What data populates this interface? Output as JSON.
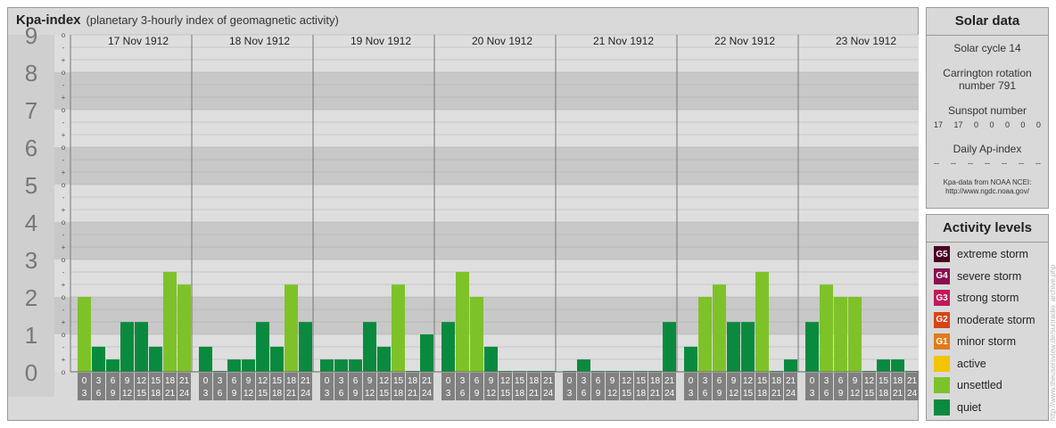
{
  "title": "Kpa-index",
  "subtitle": "(planetary 3-hourly index of geomagnetic activity)",
  "colors": {
    "quiet": "#0a8a3e",
    "unsettled": "#7ec229",
    "active": "#f5c400",
    "minor": "#e07b1a",
    "moderate": "#d84315",
    "strong": "#c2185b",
    "severe": "#880e4f",
    "extreme": "#4a0025"
  },
  "chart_data": {
    "type": "bar",
    "ylim": [
      0,
      9
    ],
    "y_ticks": [
      "0",
      "1",
      "2",
      "3",
      "4",
      "5",
      "6",
      "7",
      "8",
      "9"
    ],
    "sub_ticks": [
      "o",
      "+",
      "-"
    ],
    "days": [
      "17 Nov 1912",
      "18 Nov 1912",
      "19 Nov 1912",
      "20 Nov 1912",
      "21 Nov 1912",
      "22 Nov 1912",
      "23 Nov 1912"
    ],
    "intervals": [
      [
        "0",
        "3"
      ],
      [
        "3",
        "6"
      ],
      [
        "6",
        "9"
      ],
      [
        "9",
        "12"
      ],
      [
        "12",
        "15"
      ],
      [
        "15",
        "18"
      ],
      [
        "18",
        "21"
      ],
      [
        "21",
        "24"
      ]
    ],
    "values": [
      [
        2.0,
        0.67,
        0.33,
        1.33,
        1.33,
        0.67,
        2.67,
        2.33
      ],
      [
        0.67,
        0,
        0.33,
        0.33,
        1.33,
        0.67,
        2.33,
        1.33
      ],
      [
        0.33,
        0.33,
        0.33,
        1.33,
        0.67,
        2.33,
        0,
        1.0
      ],
      [
        1.33,
        2.67,
        2.0,
        0.67,
        0,
        0,
        0,
        0
      ],
      [
        0,
        0.33,
        0,
        0,
        0,
        0,
        0,
        1.33
      ],
      [
        0.67,
        2.0,
        2.33,
        1.33,
        1.33,
        2.67,
        0,
        0.33
      ],
      [
        1.33,
        2.33,
        2.0,
        2.0,
        0,
        0.33,
        0.33,
        0
      ]
    ]
  },
  "solar_data": {
    "title": "Solar data",
    "solar_cycle": "Solar cycle 14",
    "carrington": [
      "Carrington rotation",
      "number 791"
    ],
    "sunspot_title": "Sunspot number",
    "sunspot_values": [
      "17",
      "17",
      "0",
      "0",
      "0",
      "0",
      "0"
    ],
    "ap_title": "Daily Ap-index",
    "ap_values": [
      "--",
      "--",
      "--",
      "--",
      "--",
      "--",
      "--"
    ],
    "source": [
      "Kpa-data from NOAA NCEI:",
      "http://www.ngdc.noaa.gov/"
    ]
  },
  "activity": {
    "title": "Activity levels",
    "items": [
      {
        "badge": "G5",
        "label": "extreme storm",
        "color": "#4a0025"
      },
      {
        "badge": "G4",
        "label": "severe storm",
        "color": "#880e4f"
      },
      {
        "badge": "G3",
        "label": "strong storm",
        "color": "#c2185b"
      },
      {
        "badge": "G2",
        "label": "moderate storm",
        "color": "#d84315"
      },
      {
        "badge": "G1",
        "label": "minor storm",
        "color": "#e07b1a"
      },
      {
        "badge": "",
        "label": "active",
        "color": "#f5c400"
      },
      {
        "badge": "",
        "label": "unsettled",
        "color": "#7ec229"
      },
      {
        "badge": "",
        "label": "quiet",
        "color": "#0a8a3e"
      }
    ]
  },
  "credit": "http://www.theusersview.de/sunradio_archive.php"
}
